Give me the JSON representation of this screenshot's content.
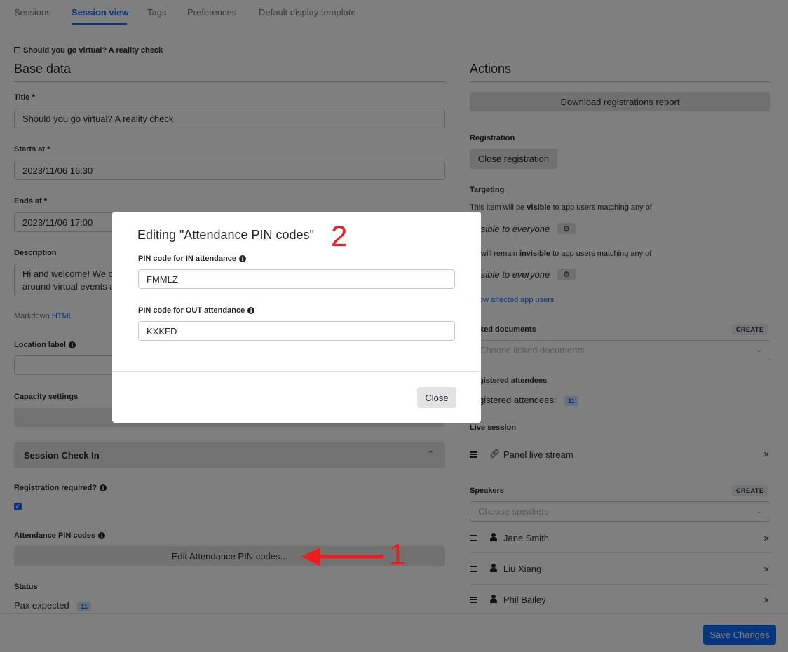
{
  "tabs": [
    {
      "label": "Sessions",
      "active": false
    },
    {
      "label": "Session view",
      "active": true
    },
    {
      "label": "Tags",
      "active": false
    },
    {
      "label": "Preferences",
      "active": false
    },
    {
      "label": "Default display template",
      "active": false
    }
  ],
  "breadcrumb": "Should you go virtual? A reality check",
  "base": {
    "heading": "Base data",
    "title_label": "Title *",
    "title_value": "Should you go virtual? A reality check",
    "starts_label": "Starts at *",
    "starts_value": "2023/11/06 16:30",
    "ends_label": "Ends at *",
    "ends_value": "2023/11/06 17:00",
    "description_label": "Description",
    "description_line1": "Hi and welcome! We c",
    "description_line2": "around virtual events a",
    "markdown_label": "Markdown",
    "markdown_link": "HTML",
    "location_label": "Location label",
    "capacity_label": "Capacity settings",
    "checkin_heading": "Session Check In",
    "registration_required_label": "Registration required?",
    "registration_required_checked": true,
    "attendance_pin_label": "Attendance PIN codes",
    "edit_pin_button": "Edit Attendance PIN codes...",
    "status_label": "Status",
    "pax_label": "Pax expected",
    "pax_count": "11"
  },
  "actions": {
    "heading": "Actions",
    "download_button": "Download registrations report",
    "registration_label": "Registration",
    "close_registration_button": "Close registration",
    "targeting_label": "Targeting",
    "visible_prefix": "This item will be ",
    "visible_word": "visible",
    "visible_suffix": " to app users matching any of",
    "visible_to_everyone_1": "isible to everyone",
    "invisible_prefix": "will remain ",
    "invisible_word": "invisible",
    "invisible_suffix": " to app users matching any of",
    "visible_to_everyone_2": "isible to everyone",
    "show_affected_link": "ow affected app users",
    "linked_docs_label": "ked documents",
    "create_label": "CREATE",
    "linked_docs_placeholder": "Choose linked documents",
    "registered_heading": "gistered attendees",
    "registered_text": "gistered attendees:",
    "registered_count": "11",
    "live_session_label": "Live session",
    "live_stream_item": "Panel live stream",
    "speakers_label": "Speakers",
    "speakers_create": "CREATE",
    "speakers_placeholder": "Choose speakers",
    "speakers": [
      "Jane Smith",
      "Liu Xiang",
      "Phil Bailey"
    ]
  },
  "save_button": "Save Changes",
  "modal": {
    "title": "Editing \"Attendance PIN codes\"",
    "in_label": "PIN code for IN attendance",
    "in_value": "FMMLZ",
    "out_label": "PIN code for OUT attendance",
    "out_value": "KXKFD",
    "close_button": "Close"
  },
  "annotations": {
    "one": "1",
    "two": "2",
    "color": "#ee1c1c"
  },
  "colors": {
    "accent": "#0d6efd",
    "backdrop": "rgba(0,0,0,0.5)"
  }
}
